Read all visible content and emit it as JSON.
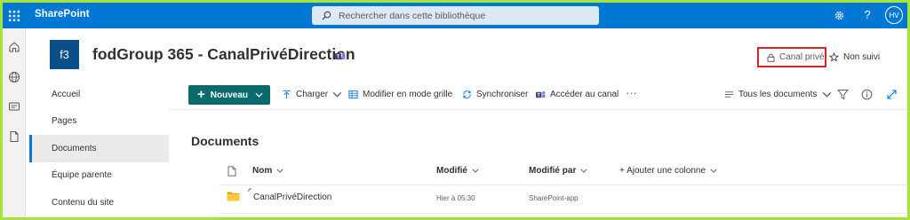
{
  "suite_bar": {
    "app_name": "SharePoint",
    "search_placeholder": "Rechercher dans cette bibliothèque",
    "user_initials": "HV",
    "help_icon": "?"
  },
  "header": {
    "site_logo": "f3",
    "site_title": "fodGroup 365 - CanalPrivéDirection",
    "channel_label": "Canal privé",
    "follow_label": "Non suivi"
  },
  "left_nav": {
    "items": [
      {
        "label": "Accueil"
      },
      {
        "label": "Pages"
      },
      {
        "label": "Documents"
      },
      {
        "label": "Équipe parente"
      },
      {
        "label": "Contenu du site"
      }
    ]
  },
  "command_bar": {
    "new_label": "Nouveau",
    "upload_label": "Charger",
    "grid_label": "Modifier en mode grille",
    "sync_label": "Synchroniser",
    "channel_label": "Accéder au canal",
    "more": "···",
    "view_label": "Tous les documents"
  },
  "library": {
    "title": "Documents",
    "columns": {
      "name": "Nom",
      "modified": "Modifié",
      "modified_by": "Modifié par",
      "add_column": "+ Ajouter une colonne"
    },
    "rows": [
      {
        "name": "CanalPrivéDirection",
        "modified": "Hier à 05:30",
        "modified_by": "SharePoint-app"
      }
    ]
  },
  "colors": {
    "suite_bar": "#0078d4",
    "new_button": "#0b6a6a",
    "site_logo": "#0b4f8a",
    "highlight_box": "#d1272b",
    "outer_border": "#a6e43a"
  },
  "icons": [
    "waffle-icon",
    "search-icon",
    "settings-icon",
    "help-icon",
    "home-icon",
    "globe-icon",
    "news-icon",
    "file-icon",
    "teams-icon",
    "lock-icon",
    "star-icon",
    "upload-icon",
    "grid-icon",
    "sync-icon",
    "teams-channel-icon",
    "view-icon",
    "filter-icon",
    "info-icon",
    "expand-icon",
    "document-icon",
    "folder-icon"
  ]
}
